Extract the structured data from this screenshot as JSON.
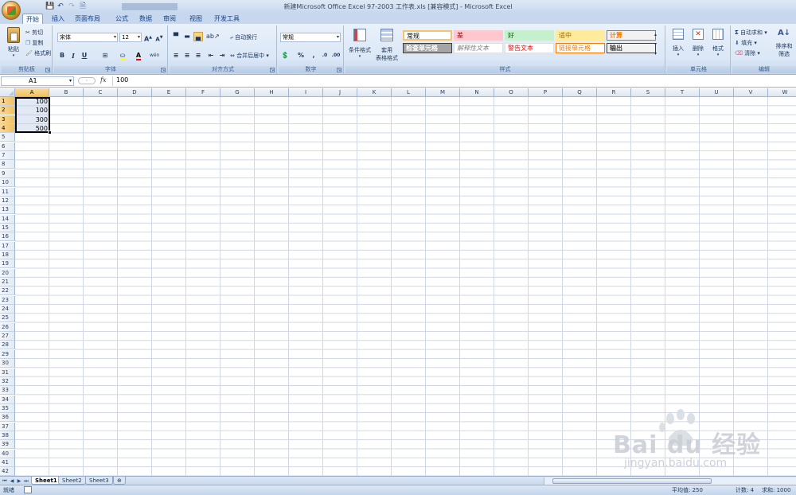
{
  "window": {
    "title": "新建Microsoft Office Excel 97-2003 工作表.xls  [兼容模式] - Microsoft Excel"
  },
  "quick_access": {
    "icons": [
      "save-icon",
      "undo-icon",
      "redo-icon",
      "print-preview-icon"
    ]
  },
  "tabs": [
    "开始",
    "插入",
    "页面布局",
    "公式",
    "数据",
    "审阅",
    "视图",
    "开发工具"
  ],
  "active_tab": "开始",
  "ribbon": {
    "clipboard": {
      "label": "剪贴板",
      "paste": "粘贴",
      "cut": "剪切",
      "copy": "复制",
      "format_painter": "格式刷"
    },
    "font": {
      "label": "字体",
      "font_name": "宋体",
      "font_size": "12",
      "bold": "B",
      "italic": "I",
      "underline": "U",
      "grow": "A",
      "shrink": "A",
      "font_color_letter": "A",
      "phonetic": "wén"
    },
    "alignment": {
      "label": "对齐方式",
      "wrap_text": "自动换行",
      "merge_center": "合并后居中"
    },
    "number": {
      "label": "数字",
      "format": "常规",
      "percent": "%",
      "comma": ","
    },
    "styles": {
      "label": "样式",
      "conditional": "条件格式",
      "table_format_1": "套用",
      "table_format_2": "表格格式",
      "cells": [
        {
          "text": "常规",
          "bg": "#ffffff",
          "color": "#000000",
          "border": "#f3c46b"
        },
        {
          "text": "差",
          "bg": "#ffc7ce",
          "color": "#9c0006",
          "border": "#ffc7ce"
        },
        {
          "text": "好",
          "bg": "#c6efce",
          "color": "#006100",
          "border": "#c6efce"
        },
        {
          "text": "适中",
          "bg": "#ffeb9c",
          "color": "#9c6500",
          "border": "#ffeb9c"
        },
        {
          "text": "计算",
          "bg": "#f2f2f2",
          "color": "#fa7d00",
          "border": "#7f7f7f"
        },
        {
          "text": "检查单元格",
          "bg": "#a5a5a5",
          "color": "#ffffff",
          "border": "#3f3f3f"
        },
        {
          "text": "解释性文本",
          "bg": "#ffffff",
          "color": "#7f7f7f",
          "border": "#e0e0e0"
        },
        {
          "text": "警告文本",
          "bg": "#ffffff",
          "color": "#ff0000",
          "border": "#e0e0e0"
        },
        {
          "text": "链接单元格",
          "bg": "#ffffff",
          "color": "#fa7d00",
          "border": "#fa7d00"
        },
        {
          "text": "输出",
          "bg": "#f2f2f2",
          "color": "#3f3f3f",
          "border": "#3f3f3f"
        }
      ]
    },
    "cells": {
      "label": "单元格",
      "insert": "插入",
      "delete": "删除",
      "format": "格式"
    },
    "editing": {
      "label": "编辑",
      "autosum": "自动求和",
      "fill": "填充",
      "clear": "清除",
      "sort_filter_1": "排序和",
      "sort_filter_2": "筛选"
    }
  },
  "formula_bar": {
    "name_box": "A1",
    "fx": "fx",
    "content": "100"
  },
  "grid": {
    "columns": [
      "A",
      "B",
      "C",
      "D",
      "E",
      "F",
      "G",
      "H",
      "I",
      "J",
      "K",
      "L",
      "M",
      "N",
      "O",
      "P",
      "Q",
      "R",
      "S",
      "T",
      "U",
      "V",
      "W"
    ],
    "rows": 42,
    "selected_column": "A",
    "selected_rows": [
      1,
      2,
      3,
      4
    ],
    "values": [
      {
        "ref": "A1",
        "value": "100"
      },
      {
        "ref": "A2",
        "value": "100"
      },
      {
        "ref": "A3",
        "value": "300"
      },
      {
        "ref": "A4",
        "value": "500"
      }
    ]
  },
  "sheets": [
    "Sheet1",
    "Sheet2",
    "Sheet3"
  ],
  "active_sheet": "Sheet1",
  "status_bar": {
    "mode": "就绪",
    "average": "平均值: 250",
    "count": "计数: 4",
    "sum": "求和: 1000"
  },
  "watermark": {
    "logo": "Bai du 经验",
    "url": "jingyan.baidu.com"
  }
}
